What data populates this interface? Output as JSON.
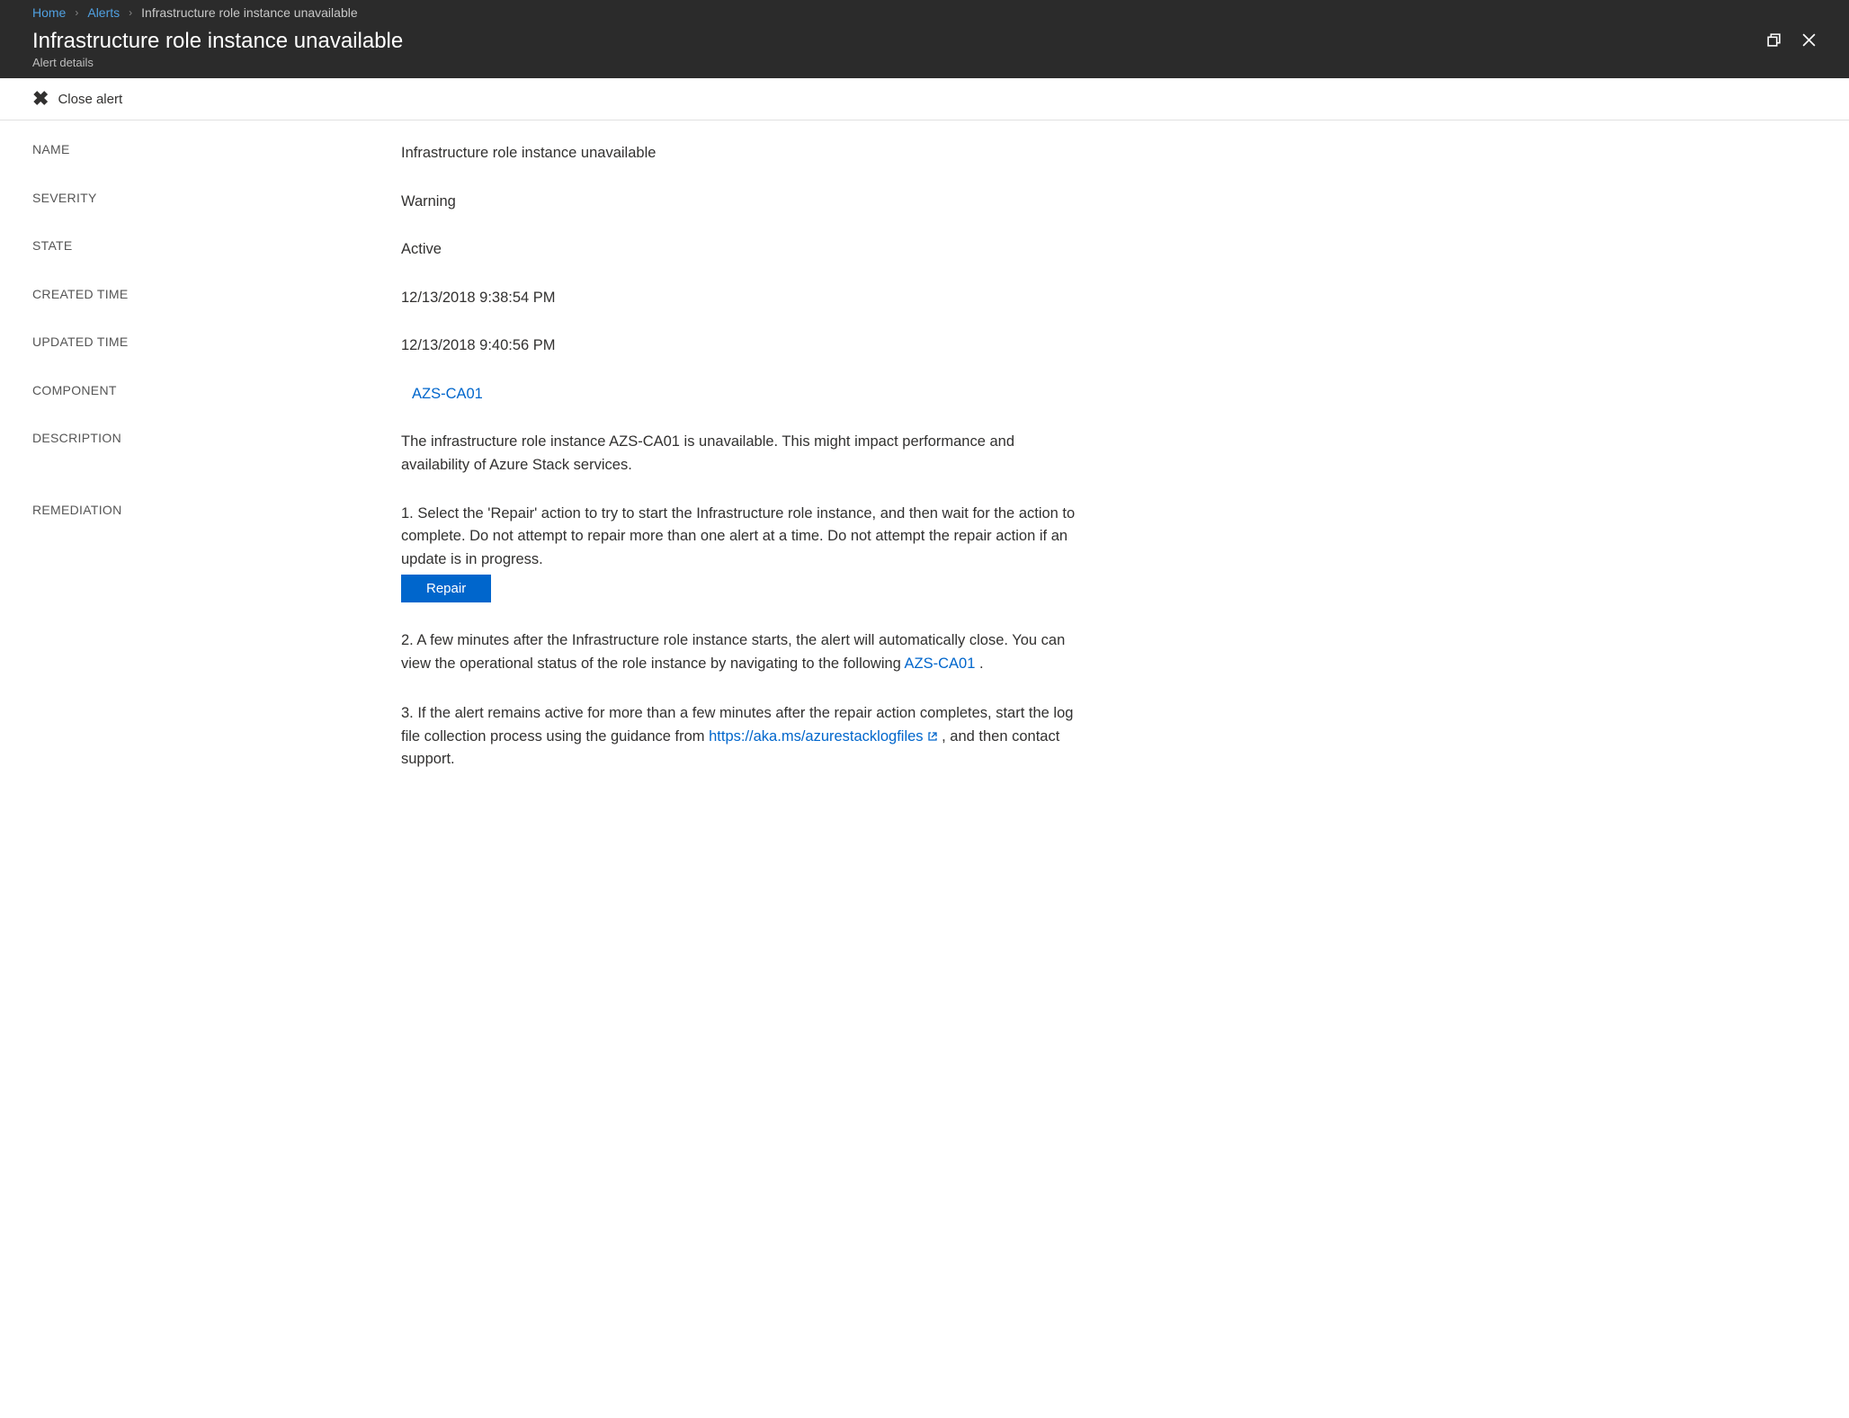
{
  "breadcrumb": {
    "home": "Home",
    "alerts": "Alerts",
    "current": "Infrastructure role instance unavailable"
  },
  "header": {
    "title": "Infrastructure role instance unavailable",
    "subtitle": "Alert details"
  },
  "toolbar": {
    "closeAlert": "Close alert"
  },
  "labels": {
    "name": "NAME",
    "severity": "SEVERITY",
    "state": "STATE",
    "created": "CREATED TIME",
    "updated": "UPDATED TIME",
    "component": "COMPONENT",
    "description": "DESCRIPTION",
    "remediation": "REMEDIATION"
  },
  "values": {
    "name": "Infrastructure role instance unavailable",
    "severity": "Warning",
    "state": "Active",
    "created": "12/13/2018 9:38:54 PM",
    "updated": "12/13/2018 9:40:56 PM",
    "component": "AZS-CA01",
    "description": "The infrastructure role instance AZS-CA01 is unavailable. This might impact performance and availability of Azure Stack services."
  },
  "remediation": {
    "step1": "1. Select the 'Repair' action to try to start the Infrastructure role instance, and then wait for the action to complete. Do not attempt to repair more than one alert at a time. Do not attempt the repair action if an update is in progress.",
    "repair": "Repair",
    "step2_a": "2. A few minutes after the Infrastructure role instance starts, the alert will automatically close. You can view the operational status of the role instance by navigating to the following ",
    "step2_link": "AZS-CA01",
    "step2_b": " .",
    "step3_a": "3. If the alert remains active for more than a few minutes after the repair action completes, start the log file collection process using the guidance from ",
    "step3_link": "https://aka.ms/azurestacklogfiles",
    "step3_b": " , and then contact support."
  }
}
